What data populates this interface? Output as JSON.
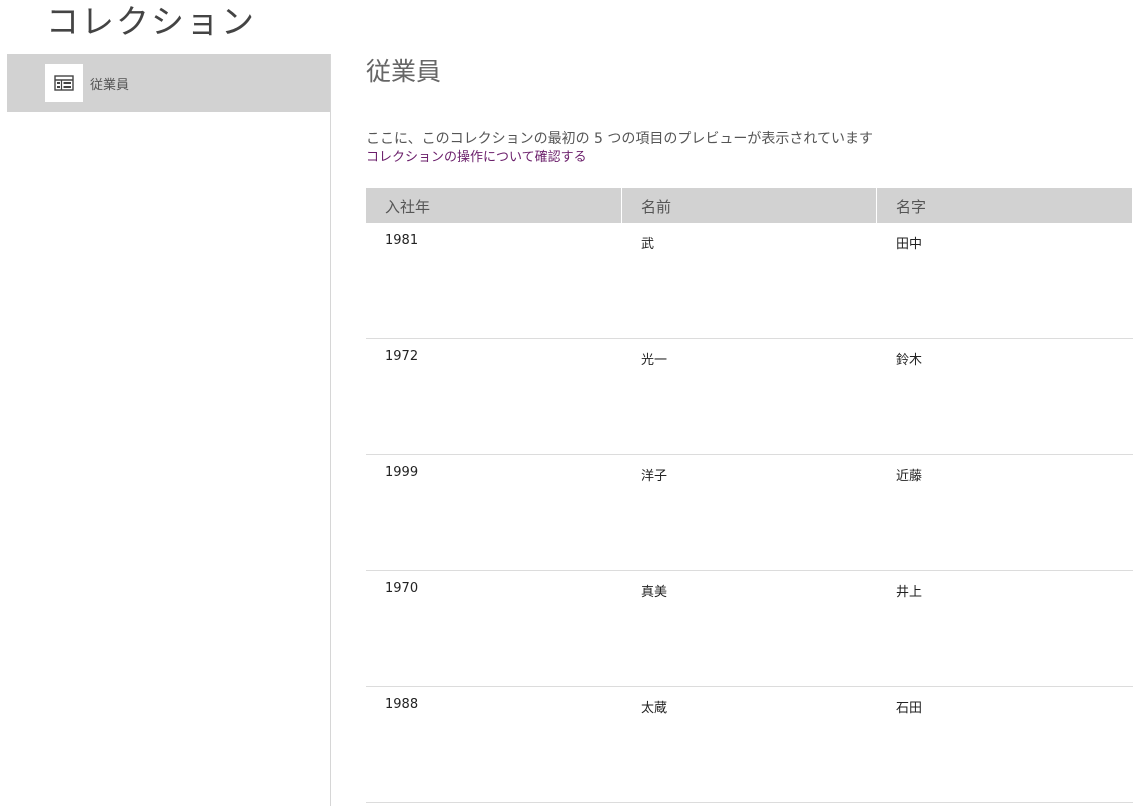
{
  "header": {
    "title": "コレクション"
  },
  "sidebar": {
    "items": [
      {
        "label": "従業員",
        "icon": "collection-table-icon",
        "selected": true
      }
    ]
  },
  "main": {
    "title": "従業員",
    "description": "ここに、このコレクションの最初の 5 つの項目のプレビューが表示されています",
    "link": "コレクションの操作について確認する",
    "table": {
      "columns": [
        "入社年",
        "名前",
        "名字"
      ],
      "rows": [
        [
          "1981",
          "武",
          "田中"
        ],
        [
          "1972",
          "光一",
          "鈴木"
        ],
        [
          "1999",
          "洋子",
          "近藤"
        ],
        [
          "1970",
          "真美",
          "井上"
        ],
        [
          "1988",
          "太蔵",
          "石田"
        ]
      ]
    }
  },
  "colors": {
    "selected_bg": "#d2d2d2",
    "link": "#6b1f6b",
    "divider": "#dcdcdc"
  }
}
